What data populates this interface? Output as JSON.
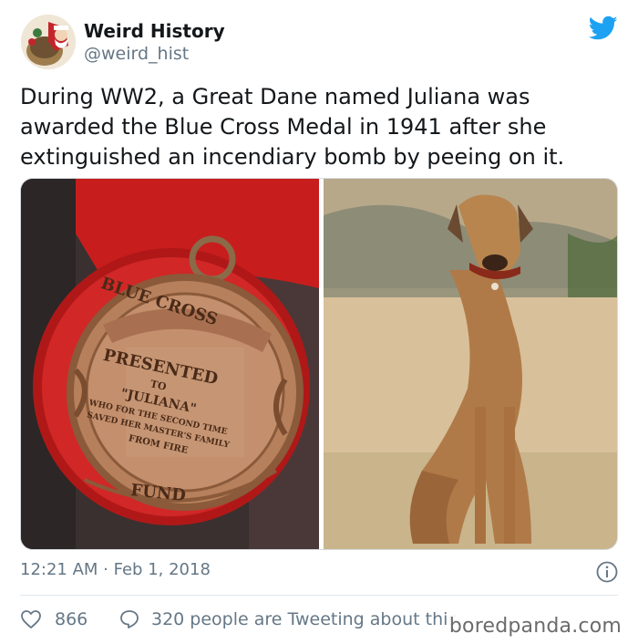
{
  "author": {
    "display_name": "Weird History",
    "handle": "@weird_hist",
    "avatar_icon": "vintage-santa-avatar"
  },
  "brand_icon": "twitter-bird-icon",
  "brand_color": "#1da1f2",
  "tweet": {
    "text": "During WW2, a Great Dane named Juliana was awarded the Blue Cross Medal in 1941 after she extinguished an incendiary bomb by peeing on it."
  },
  "media": [
    {
      "medal_text": {
        "top_arc": "BLUE CROSS",
        "line1": "PRESENTED",
        "line2": "TO",
        "line3": "\"JULIANA\"",
        "line4": "WHO FOR THE SECOND TIME",
        "line5": "SAVED HER MASTER'S FAMILY",
        "line6": "FROM FIRE",
        "bottom": "FUND"
      }
    },
    {}
  ],
  "timestamp": "12:21 AM · Feb 1, 2018",
  "info_icon": "info-icon",
  "stats": {
    "likes": "866",
    "tweeting": "320 people are Tweeting about this"
  },
  "watermark": "boredpanda.com"
}
